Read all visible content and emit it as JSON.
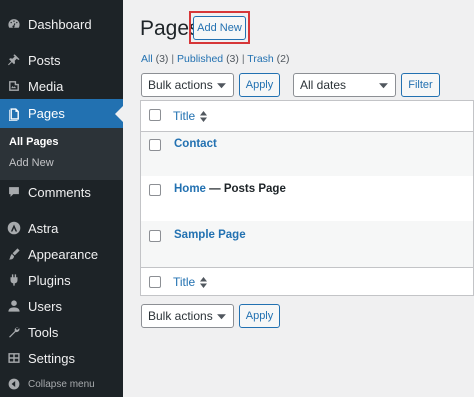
{
  "sidebar": {
    "items": [
      {
        "label": "Dashboard",
        "icon": "dashboard-icon"
      },
      {
        "label": "Posts",
        "icon": "pin-icon"
      },
      {
        "label": "Media",
        "icon": "media-icon"
      },
      {
        "label": "Pages",
        "icon": "pages-icon",
        "active": true
      },
      {
        "label": "Comments",
        "icon": "comments-icon"
      },
      {
        "label": "Astra",
        "icon": "astra-icon"
      },
      {
        "label": "Appearance",
        "icon": "appearance-icon"
      },
      {
        "label": "Plugins",
        "icon": "plugins-icon"
      },
      {
        "label": "Users",
        "icon": "users-icon"
      },
      {
        "label": "Tools",
        "icon": "tools-icon"
      },
      {
        "label": "Settings",
        "icon": "settings-icon"
      }
    ],
    "submenu": [
      {
        "label": "All Pages",
        "current": true
      },
      {
        "label": "Add New"
      }
    ],
    "collapse_label": "Collapse menu"
  },
  "header": {
    "title": "Pages",
    "add_new_label": "Add New"
  },
  "filters": {
    "all_label": "All",
    "all_count": "(3)",
    "published_label": "Published",
    "published_count": "(3)",
    "trash_label": "Trash",
    "trash_count": "(2)",
    "separator": "|"
  },
  "top_actions": {
    "bulk_actions": "Bulk actions",
    "apply_label": "Apply",
    "dates": "All dates",
    "filter_label": "Filter"
  },
  "table": {
    "column_title": "Title",
    "rows": [
      {
        "title": "Contact",
        "state": ""
      },
      {
        "title": "Home",
        "state": " — Posts Page"
      },
      {
        "title": "Sample Page",
        "state": ""
      }
    ]
  },
  "bottom_actions": {
    "bulk_actions": "Bulk actions",
    "apply_label": "Apply"
  },
  "colors": {
    "sidebar_bg": "#1d2327",
    "accent": "#2271b1",
    "highlight_border": "#d63638"
  }
}
